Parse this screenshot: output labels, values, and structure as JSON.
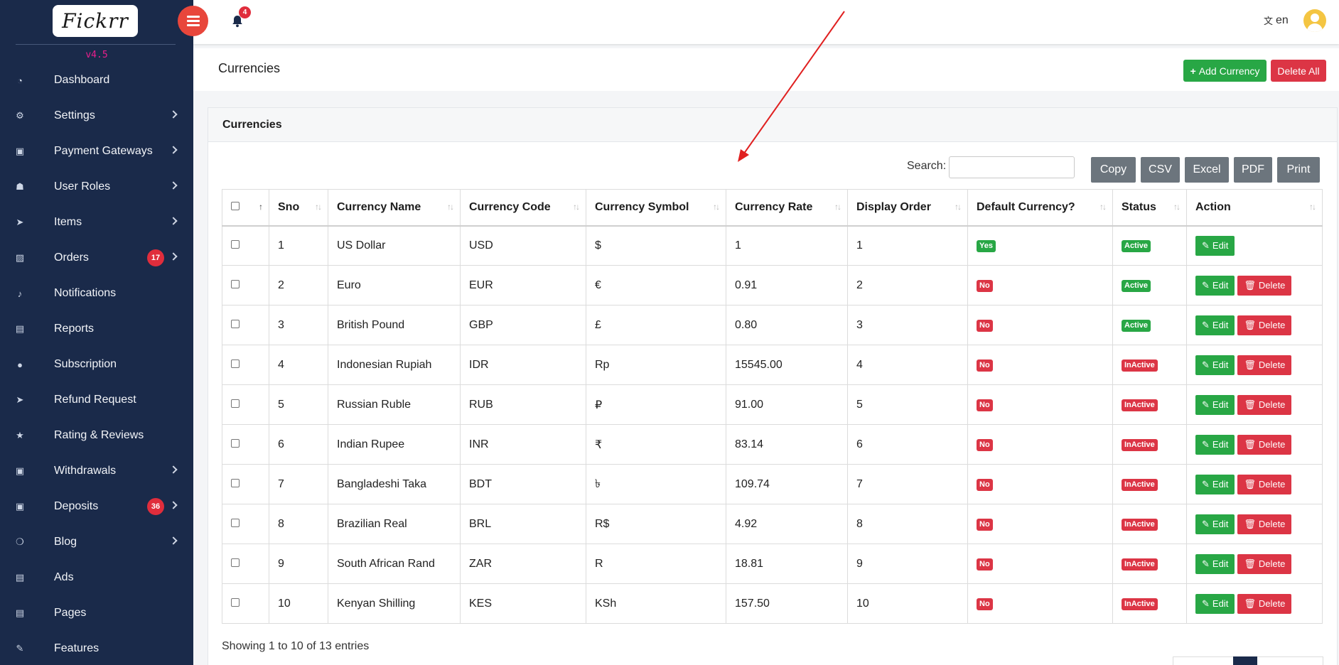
{
  "sidebar": {
    "logo_text": "Fickrr",
    "version": "v4.5",
    "items": [
      {
        "label": "Dashboard",
        "icon": "dashboard-icon",
        "glyph": "◔",
        "chevron": false,
        "badge": ""
      },
      {
        "label": "Settings",
        "icon": "gears-icon",
        "glyph": "⚙",
        "chevron": true,
        "badge": ""
      },
      {
        "label": "Payment Gateways",
        "icon": "money-icon",
        "glyph": "▣",
        "chevron": true,
        "badge": ""
      },
      {
        "label": "User Roles",
        "icon": "users-icon",
        "glyph": "☗",
        "chevron": true,
        "badge": ""
      },
      {
        "label": "Items",
        "icon": "paper-plane-icon",
        "glyph": "➤",
        "chevron": true,
        "badge": ""
      },
      {
        "label": "Orders",
        "icon": "image-icon",
        "glyph": "▨",
        "chevron": true,
        "badge": "17"
      },
      {
        "label": "Notifications",
        "icon": "bell-icon",
        "glyph": "♪",
        "chevron": false,
        "badge": ""
      },
      {
        "label": "Reports",
        "icon": "file-icon",
        "glyph": "▤",
        "chevron": false,
        "badge": ""
      },
      {
        "label": "Subscription",
        "icon": "user-icon",
        "glyph": "●",
        "chevron": false,
        "badge": ""
      },
      {
        "label": "Refund Request",
        "icon": "send-icon",
        "glyph": "➤",
        "chevron": false,
        "badge": ""
      },
      {
        "label": "Rating & Reviews",
        "icon": "star-icon",
        "glyph": "★",
        "chevron": false,
        "badge": ""
      },
      {
        "label": "Withdrawals",
        "icon": "money-icon",
        "glyph": "▣",
        "chevron": true,
        "badge": ""
      },
      {
        "label": "Deposits",
        "icon": "money-icon",
        "glyph": "▣",
        "chevron": true,
        "badge": "36"
      },
      {
        "label": "Blog",
        "icon": "comments-icon",
        "glyph": "❍",
        "chevron": true,
        "badge": ""
      },
      {
        "label": "Ads",
        "icon": "file-text-icon",
        "glyph": "▤",
        "chevron": false,
        "badge": ""
      },
      {
        "label": "Pages",
        "icon": "file-text-icon",
        "glyph": "▤",
        "chevron": false,
        "badge": ""
      },
      {
        "label": "Features",
        "icon": "magic-wand-icon",
        "glyph": "✎",
        "chevron": false,
        "badge": ""
      }
    ]
  },
  "topbar": {
    "notification_count": "4",
    "language": "en"
  },
  "page": {
    "title": "Currencies",
    "add_button": "Add Currency",
    "delete_all_button": "Delete All"
  },
  "card": {
    "title": "Currencies",
    "search_label": "Search:",
    "export_buttons": [
      "Copy",
      "CSV",
      "Excel",
      "PDF",
      "Print"
    ],
    "columns": [
      "Sno",
      "Currency Name",
      "Currency Code",
      "Currency Symbol",
      "Currency Rate",
      "Display Order",
      "Default Currency?",
      "Status",
      "Action"
    ],
    "edit_label": "Edit",
    "delete_label": "Delete",
    "rows": [
      {
        "sno": "1",
        "name": "US Dollar",
        "code": "USD",
        "symbol": "$",
        "rate": "1",
        "order": "1",
        "default": "Yes",
        "status": "Active",
        "deletable": false
      },
      {
        "sno": "2",
        "name": "Euro",
        "code": "EUR",
        "symbol": "€",
        "rate": "0.91",
        "order": "2",
        "default": "No",
        "status": "Active",
        "deletable": true
      },
      {
        "sno": "3",
        "name": "British Pound",
        "code": "GBP",
        "symbol": "£",
        "rate": "0.80",
        "order": "3",
        "default": "No",
        "status": "Active",
        "deletable": true
      },
      {
        "sno": "4",
        "name": "Indonesian Rupiah",
        "code": "IDR",
        "symbol": "Rp",
        "rate": "15545.00",
        "order": "4",
        "default": "No",
        "status": "InActive",
        "deletable": true
      },
      {
        "sno": "5",
        "name": "Russian Ruble",
        "code": "RUB",
        "symbol": "₽",
        "rate": "91.00",
        "order": "5",
        "default": "No",
        "status": "InActive",
        "deletable": true
      },
      {
        "sno": "6",
        "name": "Indian Rupee",
        "code": "INR",
        "symbol": "₹",
        "rate": "83.14",
        "order": "6",
        "default": "No",
        "status": "InActive",
        "deletable": true
      },
      {
        "sno": "7",
        "name": "Bangladeshi Taka",
        "code": "BDT",
        "symbol": "৳",
        "rate": "109.74",
        "order": "7",
        "default": "No",
        "status": "InActive",
        "deletable": true
      },
      {
        "sno": "8",
        "name": "Brazilian Real",
        "code": "BRL",
        "symbol": "R$",
        "rate": "4.92",
        "order": "8",
        "default": "No",
        "status": "InActive",
        "deletable": true
      },
      {
        "sno": "9",
        "name": "South African Rand",
        "code": "ZAR",
        "symbol": "R",
        "rate": "18.81",
        "order": "9",
        "default": "No",
        "status": "InActive",
        "deletable": true
      },
      {
        "sno": "10",
        "name": "Kenyan Shilling",
        "code": "KES",
        "symbol": "KSh",
        "rate": "157.50",
        "order": "10",
        "default": "No",
        "status": "InActive",
        "deletable": true
      }
    ],
    "info": "Showing 1 to 10 of 13 entries"
  },
  "colors": {
    "sidebar_bg": "#1a2a4a",
    "success": "#28a745",
    "danger": "#dc3545",
    "menu_button": "#e8463b",
    "version_text": "#e91e8c",
    "annotation_arrow": "#e02020"
  }
}
